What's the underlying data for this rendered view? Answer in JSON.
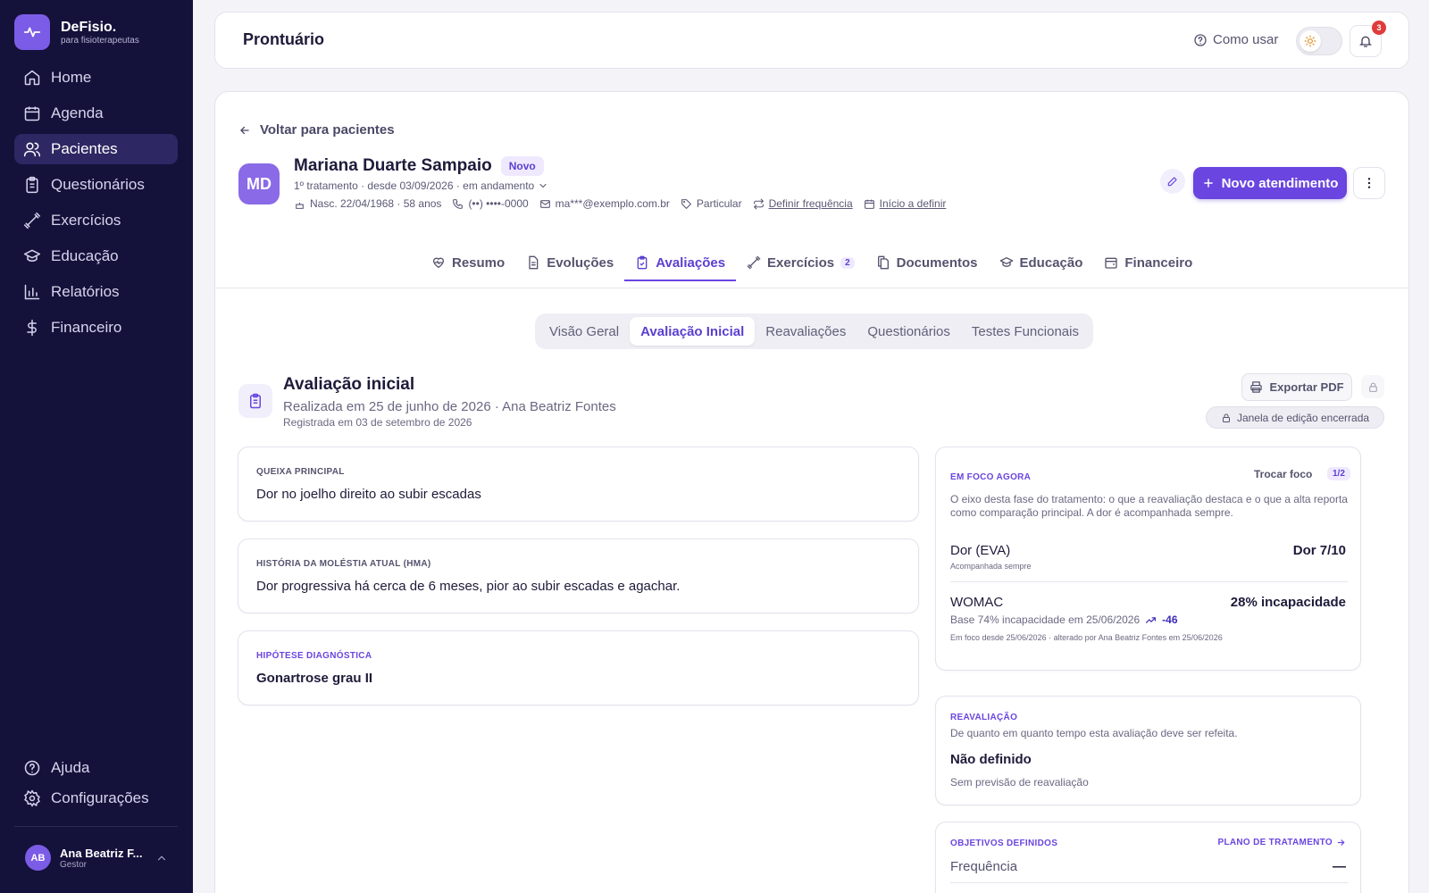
{
  "app": {
    "name": "DeFisio.",
    "tagline": "para fisioterapeutas"
  },
  "sidebar": {
    "items": [
      {
        "label": "Home",
        "icon": "home-icon"
      },
      {
        "label": "Agenda",
        "icon": "calendar-icon"
      },
      {
        "label": "Pacientes",
        "icon": "users-icon",
        "active": true
      },
      {
        "label": "Questionários",
        "icon": "clipboard-icon"
      },
      {
        "label": "Exercícios",
        "icon": "dumbbell-icon"
      },
      {
        "label": "Educação",
        "icon": "graduation-cap-icon"
      },
      {
        "label": "Relatórios",
        "icon": "bar-chart-icon"
      },
      {
        "label": "Financeiro",
        "icon": "dollar-icon"
      }
    ],
    "bottom": [
      {
        "label": "Ajuda",
        "icon": "help-circle-icon"
      },
      {
        "label": "Configurações",
        "icon": "gear-icon"
      }
    ],
    "user": {
      "initials": "AB",
      "name": "Ana Beatriz F...",
      "role": "Gestor"
    }
  },
  "header": {
    "title": "Prontuário",
    "help_label": "Como usar",
    "notifications": "3"
  },
  "patient": {
    "back_label": "Voltar para pacientes",
    "initials": "MD",
    "name": "Mariana Duarte Sampaio",
    "badge": "Novo",
    "status": "1º tratamento · desde 03/09/2026 · em andamento",
    "birth": "Nasc. 22/04/1968 · 58 anos",
    "phone": "(••) ••••-0000",
    "email": "ma***@exemplo.com.br",
    "insurance": "Particular",
    "frequency": "Definir frequência",
    "start": "Início a definir",
    "new_button": "Novo atendimento"
  },
  "tabs": [
    {
      "label": "Resumo",
      "icon": "heart-pulse-icon"
    },
    {
      "label": "Evoluções",
      "icon": "file-text-icon"
    },
    {
      "label": "Avaliações",
      "icon": "clipboard-check-icon",
      "active": true
    },
    {
      "label": "Exercícios",
      "icon": "dumbbell-icon",
      "count": "2"
    },
    {
      "label": "Documentos",
      "icon": "documents-icon"
    },
    {
      "label": "Educação",
      "icon": "graduation-cap-icon"
    },
    {
      "label": "Financeiro",
      "icon": "wallet-icon"
    }
  ],
  "subtabs": [
    "Visão Geral",
    "Avaliação Inicial",
    "Reavaliações",
    "Questionários",
    "Testes Funcionais"
  ],
  "assessment": {
    "title": "Avaliação inicial",
    "subtitle": "Realizada em 25 de junho de 2026 · Ana Beatriz Fontes",
    "registered": "Registrada em 03 de setembro de 2026",
    "export_label": "Exportar PDF",
    "edit_closed": "Janela de edição encerrada",
    "complaint": {
      "label": "QUEIXA PRINCIPAL",
      "value": "Dor no joelho direito ao subir escadas"
    },
    "history": {
      "label": "HISTÓRIA DA MOLÉSTIA ATUAL (HMA)",
      "value": "Dor progressiva há cerca de 6 meses, pior ao subir escadas e agachar."
    },
    "diagnosis": {
      "label": "HIPÓTESE DIAGNÓSTICA",
      "value": "Gonartrose grau II"
    }
  },
  "focus": {
    "label": "EM FOCO AGORA",
    "switch_label": "Trocar foco",
    "page": "1/2",
    "description": "O eixo desta fase do tratamento: o que a reavaliação destaca e o que a alta reporta como comparação principal. A dor é acompanhada sempre.",
    "pain_name": "Dor (EVA)",
    "pain_note": "Acompanhada sempre",
    "pain_value": "Dor 7/10",
    "womac_name": "WOMAC",
    "womac_value": "28% incapacidade",
    "womac_base": "Base 74% incapacidade em 25/06/2026",
    "womac_delta": "-46",
    "womac_since": "Em foco desde 25/06/2026 · alterado por Ana Beatriz Fontes em 25/06/2026"
  },
  "reassessment": {
    "label": "REAVALIAÇÃO",
    "question": "De quanto em quanto tempo esta avaliação deve ser refeita.",
    "value": "Não definido",
    "note": "Sem previsão de reavaliação"
  },
  "objectives": {
    "label": "OBJETIVOS DEFINIDOS",
    "plan_link": "PLANO DE TRATAMENTO",
    "item": "Frequência",
    "item_value": "—"
  }
}
